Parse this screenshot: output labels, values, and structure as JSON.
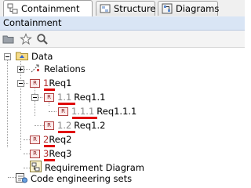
{
  "tabs": [
    {
      "label": "Containment",
      "active": true
    },
    {
      "label": "Structure",
      "active": false
    },
    {
      "label": "Diagrams",
      "active": false
    }
  ],
  "panel_title": "Containment",
  "toolbar": {
    "icons": [
      "folder-add-icon",
      "star-icon",
      "search-icon"
    ]
  },
  "tree": {
    "root": "Data",
    "relations": "Relations",
    "req1": {
      "num": "1",
      "name": "Req1"
    },
    "req1_1": {
      "num": "1.1",
      "name": "Req1.1"
    },
    "req1_1_1": {
      "num": "1.1.1",
      "name": "Req1.1.1"
    },
    "req1_2": {
      "num": "1.2",
      "name": "Req1.2"
    },
    "req2": {
      "num": "2",
      "name": "Req2"
    },
    "req3": {
      "num": "3",
      "name": "Req3"
    },
    "diagram": "Requirement Diagram",
    "code_sets": "Code engineering sets"
  },
  "colors": {
    "header_bg": "#d9e5f5",
    "number_red": "#b03030",
    "underline": "#e00000"
  }
}
